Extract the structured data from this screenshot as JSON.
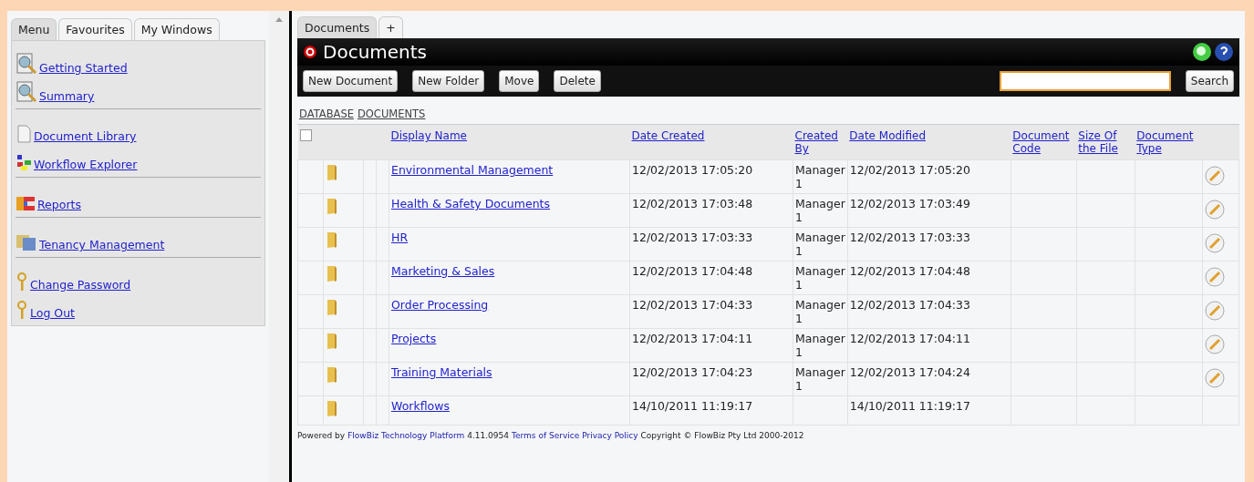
{
  "sidebar": {
    "tabs": [
      {
        "label": "Menu",
        "selected": true
      },
      {
        "label": "Favourites",
        "selected": false
      },
      {
        "label": "My Windows",
        "selected": false
      }
    ],
    "groups": [
      [
        {
          "label": "Getting Started",
          "kind": "report"
        },
        {
          "label": "Summary",
          "kind": "report"
        }
      ],
      [
        {
          "label": "Document Library",
          "kind": "page"
        },
        {
          "label": "Workflow Explorer",
          "kind": "workflow"
        }
      ],
      [
        {
          "label": "Reports",
          "kind": "chart"
        }
      ],
      [
        {
          "label": "Tenancy Management",
          "kind": "folder"
        }
      ],
      [
        {
          "label": "Change Password",
          "kind": "key"
        },
        {
          "label": "Log Out",
          "kind": "key"
        }
      ]
    ]
  },
  "window_tabs": [
    {
      "label": "Documents",
      "selected": true
    },
    {
      "label": "+",
      "selected": false
    }
  ],
  "window": {
    "title": "Documents",
    "buttons": [
      "New Document",
      "New Folder",
      "Move",
      "Delete"
    ],
    "search_button": "Search"
  },
  "breadcrumb": [
    "DATABASE",
    "DOCUMENTS"
  ],
  "select_all": {
    "checked": false
  },
  "table": {
    "columns": [
      "Display Name",
      "Date Created",
      "Created By",
      "Date Modified",
      "Document Code",
      "Size Of the File",
      "Document Type"
    ],
    "rows": [
      {
        "name": "Environmental Management",
        "created": "12/02/2013 17:05:20",
        "by": "Manager 1",
        "modified": "12/02/2013 17:05:20",
        "editable": true
      },
      {
        "name": "Health & Safety Documents",
        "created": "12/02/2013 17:03:48",
        "by": "Manager 1",
        "modified": "12/02/2013 17:03:49",
        "editable": true
      },
      {
        "name": "HR",
        "created": "12/02/2013 17:03:33",
        "by": "Manager 1",
        "modified": "12/02/2013 17:03:33",
        "editable": true
      },
      {
        "name": "Marketing & Sales",
        "created": "12/02/2013 17:04:48",
        "by": "Manager 1",
        "modified": "12/02/2013 17:04:48",
        "editable": true
      },
      {
        "name": "Order Processing",
        "created": "12/02/2013 17:04:33",
        "by": "Manager 1",
        "modified": "12/02/2013 17:04:33",
        "editable": true
      },
      {
        "name": "Projects",
        "created": "12/02/2013 17:04:11",
        "by": "Manager 1",
        "modified": "12/02/2013 17:04:11",
        "editable": true
      },
      {
        "name": "Training Materials",
        "created": "12/02/2013 17:04:23",
        "by": "Manager 1",
        "modified": "12/02/2013 17:04:24",
        "editable": true
      },
      {
        "name": "Workflows",
        "created": "14/10/2011 11:19:17",
        "by": "",
        "modified": "14/10/2011 11:19:17",
        "editable": false
      }
    ]
  },
  "footer": [
    {
      "text": "Powered by",
      "link": false
    },
    {
      "text": "FlowBiz Technology Platform",
      "link": true
    },
    {
      "text": "4.11.0954",
      "link": false
    },
    {
      "text": "Terms of Service",
      "link": true
    },
    {
      "text": "Privacy Policy",
      "link": true
    },
    {
      "text": "Copyright © FlowBiz Pty Ltd 2000-2012",
      "link": false
    }
  ]
}
